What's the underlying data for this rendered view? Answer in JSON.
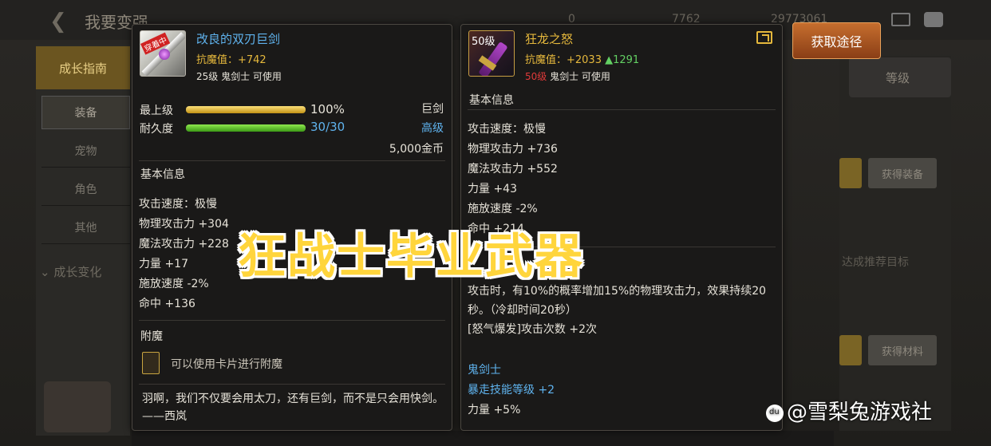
{
  "background": {
    "title": "我要变强",
    "stats": [
      "0",
      "7762",
      "29773061"
    ],
    "sidebar_main": "成长指南",
    "sidebar_items": [
      "装备",
      "宠物",
      "角色",
      "其他"
    ],
    "sidebar_sub": "成长变化",
    "level_label": "等级",
    "right_buttons": [
      "获得装备",
      "获得材料"
    ],
    "right_text": "达成推荐目标"
  },
  "left_item": {
    "name": "改良的双刃巨剑",
    "tag": "穿着中",
    "anti_magic": "抗魔值：+742",
    "requirement": "25级 鬼剑士 可使用",
    "max_level_label": "最上级",
    "max_level_value": "100%",
    "max_level_fraction": 1.0,
    "durability_label": "耐久度",
    "durability_value": "30/30",
    "durability_fraction": 1.0,
    "weapon_type": "巨剑",
    "rarity": "高级",
    "price": "5,000金币",
    "basic_info_title": "基本信息",
    "stats": [
      "攻击速度：极慢",
      "物理攻击力 +304",
      "魔法攻击力 +228",
      "力量 +17",
      "施放速度 -2%",
      "命中 +136"
    ],
    "enchant_title": "附魔",
    "enchant_text": "可以使用卡片进行附魔",
    "flavor": "羽啊，我们不仅要会用太刀，还有巨剑，而不是只会用快剑。 ——西岚"
  },
  "right_item": {
    "level_tag": "50级",
    "name": "狂龙之怒",
    "anti_magic": "抗魔值：+2033",
    "anti_magic_up": "▲1291",
    "req_level": "50级",
    "req_class": "鬼剑士 可使用",
    "basic_info_title": "基本信息",
    "stats": [
      "攻击速度：极慢",
      "物理攻击力 +736",
      "魔法攻击力 +552",
      "力量 +43",
      "施放速度 -2%",
      "命中 +214"
    ],
    "effect_lines": [
      "攻击时，有10%的概率增加15%的物理攻击力，效果持续20秒。（冷却时间20秒）",
      "[怒气爆发]攻击次数 +2次"
    ],
    "class_name": "鬼剑士",
    "skill_bonus": "暴走技能等级 +2",
    "strength_bonus": "力量 +5%"
  },
  "get_button": "获取途径",
  "overlay_title": "狂战士毕业武器",
  "watermark": "@雪梨兔游戏社",
  "colors": {
    "gold": "#e5b83c",
    "blue": "#5fb3ee",
    "green": "#63d063",
    "red": "#e03a3a",
    "button": "#c66e2e"
  }
}
